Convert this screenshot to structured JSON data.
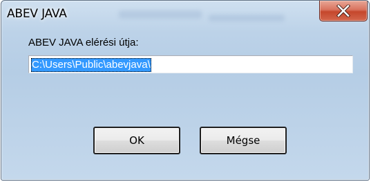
{
  "window": {
    "title": "ABEV JAVA",
    "close_icon": "close-x-icon",
    "accent_close": "#c5472c"
  },
  "form": {
    "label": "ABEV JAVA elérési útja:",
    "path_value": "C:\\Users\\Public\\abevjava\\"
  },
  "buttons": {
    "ok_label": "OK",
    "cancel_label": "Mégse"
  }
}
